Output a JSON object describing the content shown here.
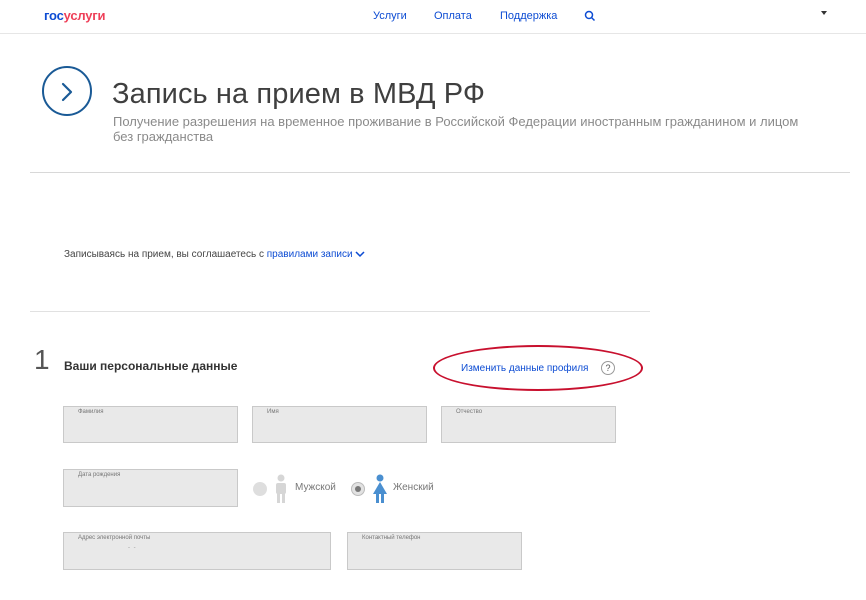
{
  "header": {
    "logo_part1": "гос",
    "logo_part2": "услуги",
    "nav": [
      "Услуги",
      "Оплата",
      "Поддержка"
    ],
    "colors": {
      "brand_blue": "#0d4cd3",
      "brand_red": "#ee3f58"
    }
  },
  "page": {
    "title": "Запись на прием в МВД РФ",
    "subtitle": "Получение разрешения на временное проживание в Российской Федерации иностранным гражданином и лицом без гражданства"
  },
  "agreement": {
    "text": "Записываясь на прием, вы соглашаетесь с ",
    "link": "правилами записи"
  },
  "step": {
    "number": "1",
    "title": "Ваши персональные данные",
    "change_profile": "Изменить данные профиля",
    "help": "?"
  },
  "fields": {
    "lastname": "Фамилия",
    "firstname": "Имя",
    "patronymic": "Отчество",
    "birthdate": "Дата рождения",
    "email": "Адрес электронной почты",
    "email_value": "-          -",
    "phone": "Контактный телефон"
  },
  "gender": {
    "male": "Мужской",
    "female": "Женский",
    "selected": "Женский"
  },
  "icons": [
    "chevron-right-icon",
    "search-icon",
    "chevron-down-icon",
    "help-icon",
    "male-icon",
    "female-icon"
  ]
}
